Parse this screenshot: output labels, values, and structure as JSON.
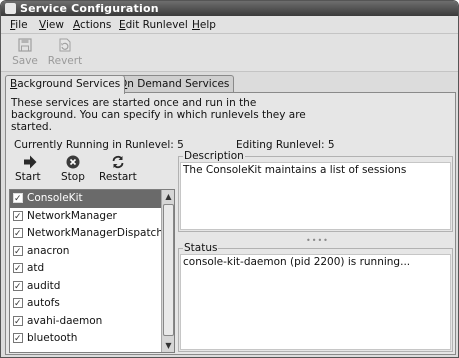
{
  "window": {
    "title": "Service Configuration"
  },
  "menu": [
    {
      "label": "File",
      "u": "F",
      "rest": "ile"
    },
    {
      "label": "View",
      "u": "V",
      "rest": "iew"
    },
    {
      "label": "Actions",
      "u": "A",
      "rest": "ctions"
    },
    {
      "label": "Edit Runlevel",
      "u": "E",
      "rest": "dit Runlevel"
    },
    {
      "label": "Help",
      "u": "H",
      "rest": "elp"
    }
  ],
  "toolbar": {
    "save_label": "Save",
    "revert_label": "Revert"
  },
  "tabs": {
    "background": {
      "u": "B",
      "rest": "ackground Services"
    },
    "ondemand": {
      "u": "O",
      "rest": "n Demand Services"
    }
  },
  "panel": {
    "description_text": "These services are started once and run in the background. You can specify in which runlevels they are started.",
    "current_runlevel": "Currently Running in Runlevel: 5",
    "editing_runlevel": "Editing Runlevel: 5"
  },
  "actions": {
    "start_label": "Start",
    "stop_label": "Stop",
    "restart_label": "Restart"
  },
  "services": [
    {
      "name": "ConsoleKit",
      "checked": true
    },
    {
      "name": "NetworkManager",
      "checked": true
    },
    {
      "name": "NetworkManagerDispatcher",
      "checked": true
    },
    {
      "name": "anacron",
      "checked": true
    },
    {
      "name": "atd",
      "checked": true
    },
    {
      "name": "auditd",
      "checked": true
    },
    {
      "name": "autofs",
      "checked": true
    },
    {
      "name": "avahi-daemon",
      "checked": true
    },
    {
      "name": "bluetooth",
      "checked": true
    }
  ],
  "description_box": {
    "label": "Description",
    "text": "The ConsoleKit maintains a list of sessions"
  },
  "status_box": {
    "label": "Status",
    "text": "console-kit-daemon (pid 2200) is running..."
  },
  "colors": {
    "selected_row": "#6a6a6a",
    "title_bar": "#4a4a4a"
  }
}
